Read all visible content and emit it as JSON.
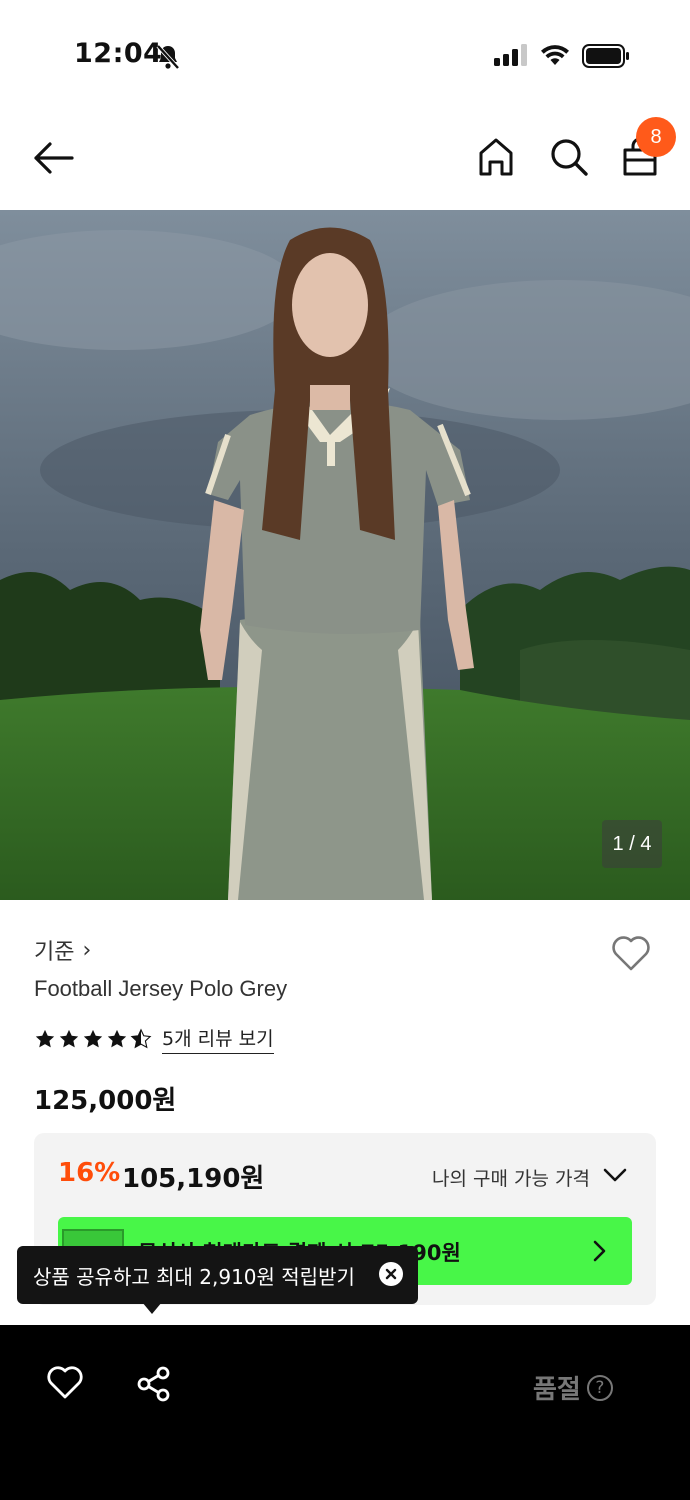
{
  "status_bar": {
    "time": "12:04"
  },
  "nav": {
    "cart_count": "8"
  },
  "gallery": {
    "counter": "1 / 4"
  },
  "product": {
    "brand": "기준",
    "brand_chevron": "›",
    "name": "Football Jersey Polo Grey",
    "rating": 4.5,
    "review_link": "5개 리뷰 보기",
    "original_price": "125,000원"
  },
  "price_box": {
    "discount_rate": "16%",
    "discount_price": "105,190원",
    "my_price_label": "나의 구매 가능 가격",
    "card_banner_text": "무신사 현대카드 결제 시 75,190원"
  },
  "tooltip": {
    "text": "상품 공유하고 최대 2,910원 적립받기"
  },
  "bottom_bar": {
    "soldout_label": "품절",
    "help_glyph": "?"
  },
  "colors": {
    "accent_orange": "#ff5a1a",
    "discount_orange": "#ff4d0a",
    "card_green": "#48f648",
    "bottom_bar": "#000000"
  }
}
